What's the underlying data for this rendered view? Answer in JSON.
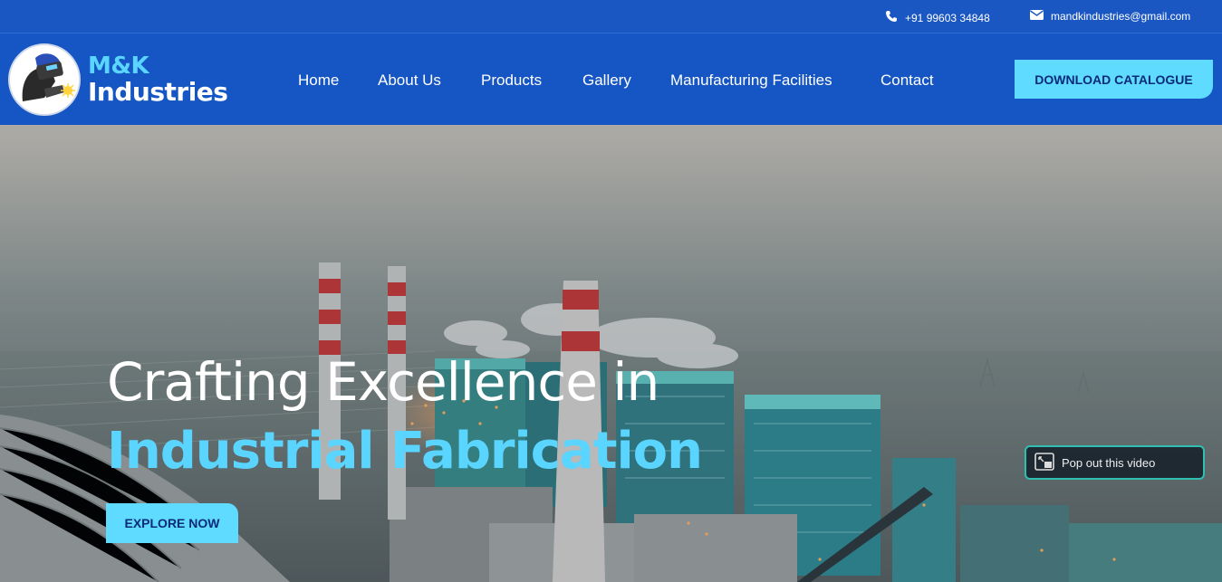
{
  "topbar": {
    "phone": "+91 99603 34848",
    "email": "mandkindustries@gmail.com",
    "icons": {
      "phone": "phone-icon",
      "email": "envelope-icon"
    }
  },
  "header": {
    "logo_line1": "M&K",
    "logo_line2": "Industries",
    "nav": [
      "Home",
      "About Us",
      "Products",
      "Gallery",
      "Manufacturing Facilities",
      "Contact"
    ],
    "cta": "DOWNLOAD CATALOGUE"
  },
  "hero": {
    "headline_line1": "Crafting Excellence in",
    "headline_line2": "Industrial Fabrication",
    "explore": "EXPLORE NOW",
    "popout": "Pop out this video"
  },
  "colors": {
    "brand_blue": "#1656c4",
    "accent_cyan": "#5fdbff",
    "cta_text": "#0a2a7a",
    "popout_border": "#2fbfb0"
  }
}
